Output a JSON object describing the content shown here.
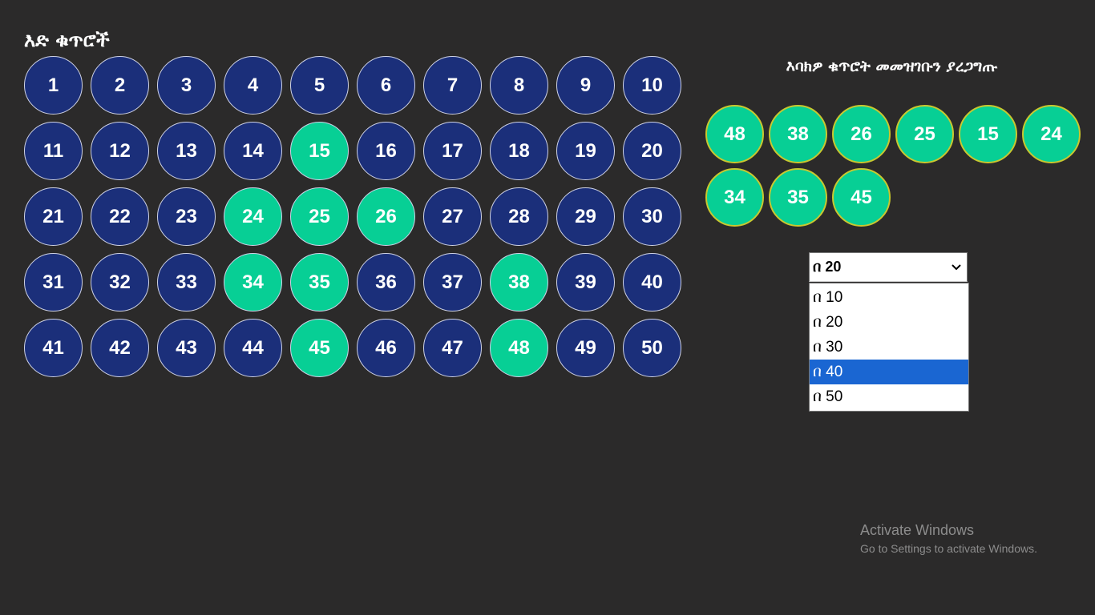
{
  "left_panel": {
    "title": "እድ ቁጥሮች",
    "numbers": [
      1,
      2,
      3,
      4,
      5,
      6,
      7,
      8,
      9,
      10,
      11,
      12,
      13,
      14,
      15,
      16,
      17,
      18,
      19,
      20,
      21,
      22,
      23,
      24,
      25,
      26,
      27,
      28,
      29,
      30,
      31,
      32,
      33,
      34,
      35,
      36,
      37,
      38,
      39,
      40,
      41,
      42,
      43,
      44,
      45,
      46,
      47,
      48,
      49,
      50
    ],
    "picked": [
      15,
      24,
      25,
      26,
      34,
      35,
      38,
      45,
      48
    ]
  },
  "right_panel": {
    "title": "እባክዎ ቁጥሮት መመዝገቡን ያረጋግጡ",
    "chosen_numbers": [
      48,
      38,
      26,
      25,
      15,
      24,
      34,
      35,
      45
    ]
  },
  "bet_select": {
    "selected_value": "በ 20",
    "options": [
      "በ 10",
      "በ 20",
      "በ 30",
      "በ 40",
      "በ 50"
    ],
    "highlighted_option": "በ 40"
  },
  "watermark": {
    "line1": "Activate Windows",
    "line2": "Go to Settings to activate Windows."
  },
  "colors": {
    "background": "#2b2a2a",
    "ball_default": "#1b2f7a",
    "ball_picked": "#07cf95",
    "chosen_border": "#c9c82f",
    "option_highlight": "#1a66d2"
  }
}
